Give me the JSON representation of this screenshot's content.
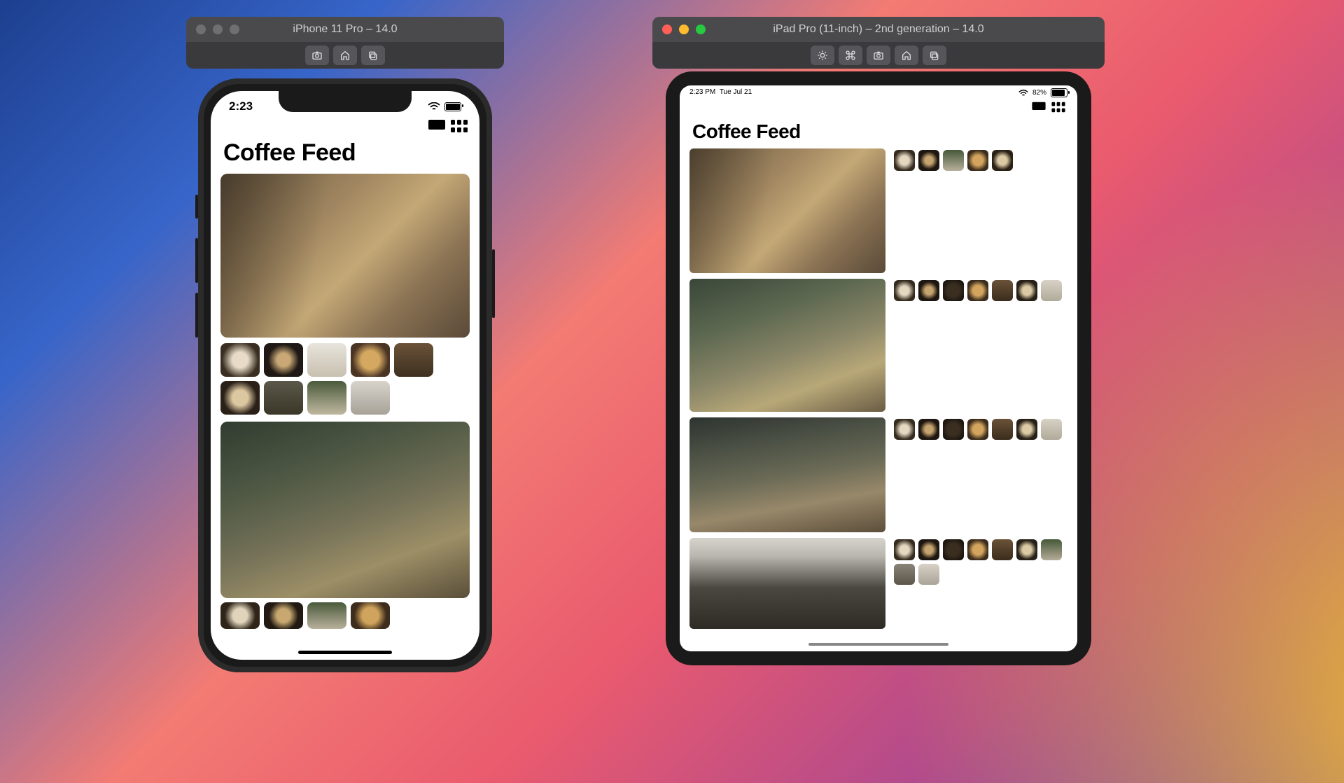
{
  "iphone_sim": {
    "title": "iPhone 11 Pro – 14.0",
    "toolbar": [
      "screenshot",
      "home",
      "share"
    ]
  },
  "ipad_sim": {
    "title": "iPad Pro (11-inch) – 2nd generation – 14.0",
    "toolbar": [
      "appearance",
      "command",
      "screenshot",
      "home",
      "share"
    ]
  },
  "iphone_status": {
    "time": "2:23",
    "battery_pct": 100
  },
  "ipad_status": {
    "time": "2:23 PM",
    "date": "Tue Jul 21",
    "battery_label": "82%",
    "battery_pct": 82
  },
  "app": {
    "title": "Coffee Feed",
    "nav_icons": [
      "list-layout",
      "grid-layout"
    ]
  },
  "iphone_feed": [
    {
      "hero": "cafe-street-terrace",
      "thumbs": [
        "latte-art-cups",
        "espresso-dark",
        "coffee-plant-top",
        "latte-heart",
        "two-cups-wood",
        "latte-swirl",
        "tray-cups",
        "leaves-beans",
        "pour-over"
      ]
    },
    {
      "hero": "cafe-indoor-plants",
      "thumbs": [
        "cups-cluster",
        "espresso-dark",
        "coffee-plant",
        "latte-heart"
      ]
    }
  ],
  "ipad_feed": [
    {
      "hero": "cafe-street-terrace",
      "thumbs": [
        "cups-cluster",
        "espresso-dark",
        "coffee-plant",
        "latte-heart",
        "pour-cup"
      ]
    },
    {
      "hero": "cafe-indoor-plants",
      "thumbs": [
        "cups-cluster",
        "espresso-dark",
        "mug-dark",
        "latte-heart",
        "two-cups",
        "latte-swirl",
        "plant-light"
      ]
    },
    {
      "hero": "industrial-cafe-wide",
      "thumbs": [
        "cups-cluster",
        "espresso-dark",
        "mug-dark",
        "latte-heart",
        "two-cups",
        "latte-swirl",
        "plant-light"
      ]
    },
    {
      "hero": "ceiling-cafe-counter",
      "thumbs": [
        "cups-cluster",
        "espresso-dark",
        "mug-dark",
        "latte-heart",
        "two-cups",
        "latte-swirl",
        "plant-light",
        "pour-hand",
        "milk-jug"
      ]
    }
  ]
}
